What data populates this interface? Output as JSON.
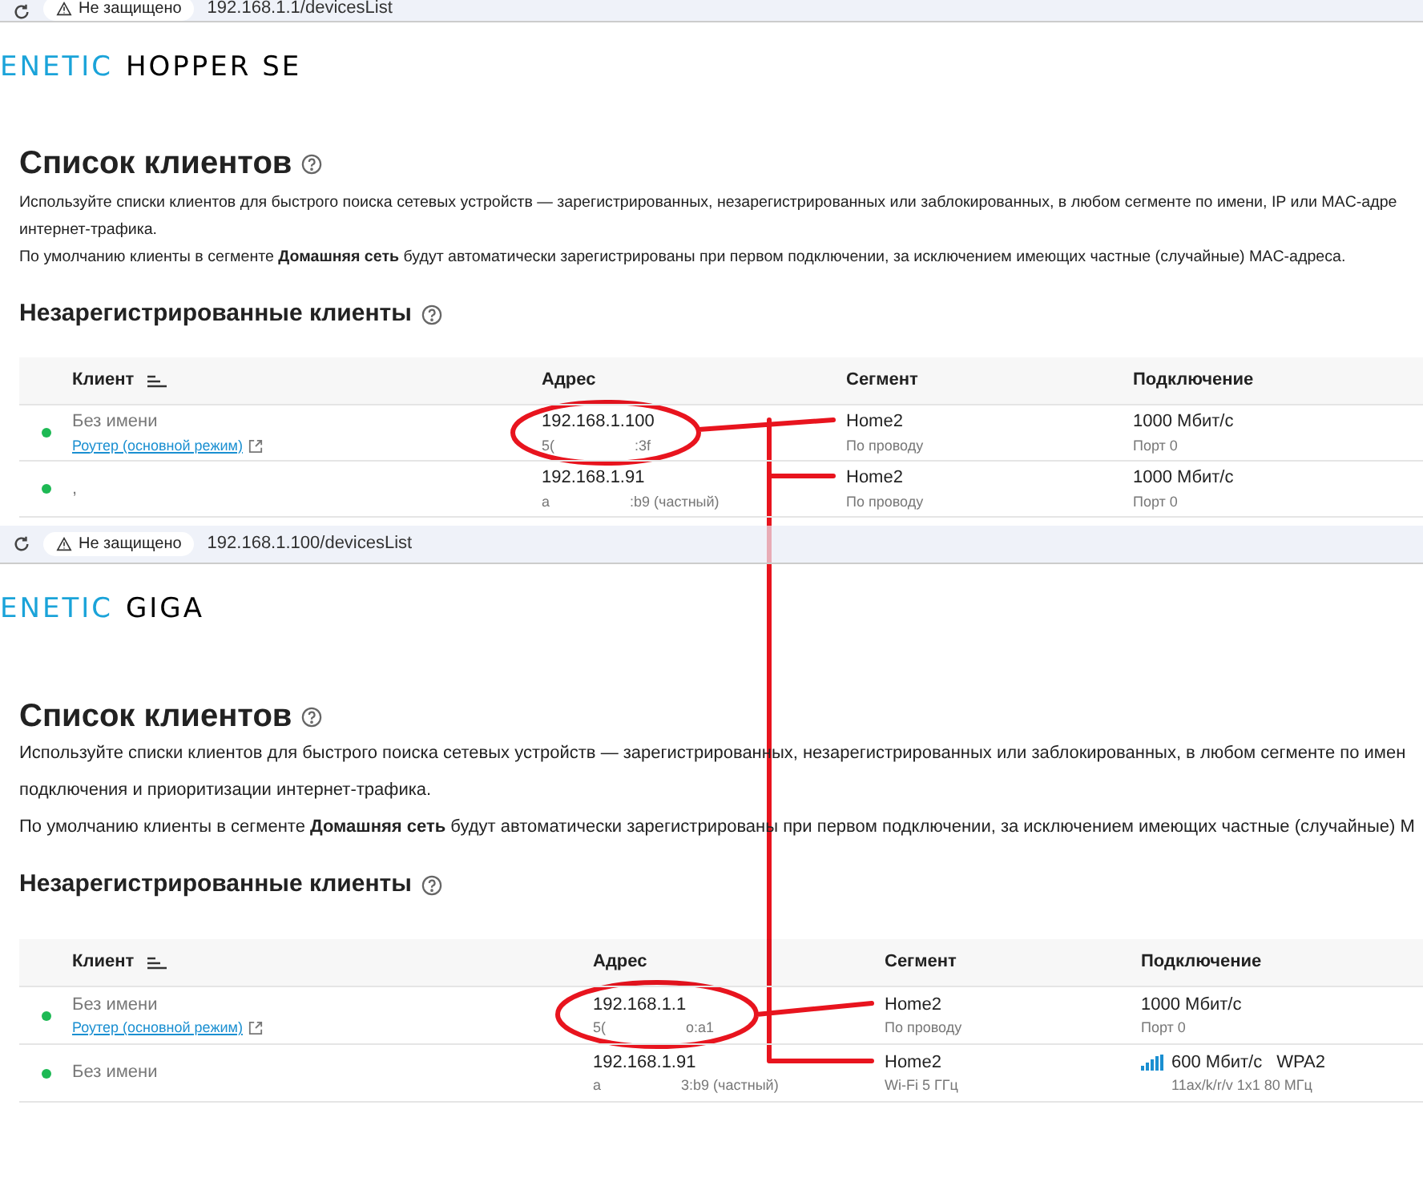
{
  "panels": [
    {
      "browser": {
        "security": "Не защищено",
        "url": "192.168.1.1/devicesList"
      },
      "logo": {
        "brand": "ENETIC",
        "model": "HOPPER SE"
      },
      "title": "Список клиентов",
      "description": [
        "Используйте списки клиентов для быстрого поиска сетевых устройств — зарегистрированных, незарегистрированных или заблокированных, в любом сегменте по имени, IP или MAC-адре",
        "интернет-трафика.",
        "По умолчанию клиенты в сегменте **Домашняя сеть** будут автоматически зарегистрированы при первом подключении, за исключением имеющих частные (случайные) MAC-адреса."
      ],
      "section": "Незарегистрированные клиенты",
      "table": {
        "columns": [
          "Клиент",
          "Адрес",
          "Сегмент",
          "Подключение"
        ],
        "rows": [
          {
            "online": true,
            "name": "Без имени",
            "link": "Роутер (основной режим)",
            "ip": "192.168.1.100",
            "mac_start": "5(",
            "mac_end": ":3f",
            "segment": "Home2",
            "segment_type": "По проводу",
            "kind": "wired",
            "speed": "1000 Мбит/с",
            "port": "Порт 0"
          },
          {
            "online": true,
            "name": ",",
            "ip": "192.168.1.91",
            "mac_start": "a",
            "mac_end": ":b9 (частный)",
            "segment": "Home2",
            "segment_type": "По проводу",
            "kind": "wired",
            "speed": "1000 Мбит/с",
            "port": "Порт 0"
          }
        ]
      }
    },
    {
      "browser": {
        "security": "Не защищено",
        "url": "192.168.1.100/devicesList"
      },
      "logo": {
        "brand": "ENETIC",
        "model": "GIGA"
      },
      "title": "Список клиентов",
      "description": [
        "Используйте списки клиентов для быстрого поиска сетевых устройств — зарегистрированных, незарегистрированных или заблокированных, в любом сегменте по имен",
        "подключения и приоритизации интернет-трафика.",
        "По умолчанию клиенты в сегменте **Домашняя сеть** будут автоматически зарегистрированы при первом подключении, за исключением имеющих частные (случайные) М"
      ],
      "section": "Незарегистрированные клиенты",
      "table": {
        "columns": [
          "Клиент",
          "Адрес",
          "Сегмент",
          "Подключение"
        ],
        "rows": [
          {
            "online": true,
            "name": "Без имени",
            "link": "Роутер (основной режим)",
            "ip": "192.168.1.1",
            "mac_start": "5(",
            "mac_end": "o:a1",
            "segment": "Home2",
            "segment_type": "По проводу",
            "kind": "wired",
            "speed": "1000 Мбит/с",
            "port": "Порт 0"
          },
          {
            "online": true,
            "name": "Без имени",
            "ip": "192.168.1.91",
            "mac_start": "a",
            "mac_end": "3:b9 (частный)",
            "segment": "Home2",
            "segment_type": "Wi-Fi 5 ГГц",
            "kind": "wifi",
            "speed": "600 Мбит/с",
            "security": "WPA2",
            "standard": "11ax/k/r/v 1x1 80 МГц"
          }
        ]
      }
    }
  ]
}
